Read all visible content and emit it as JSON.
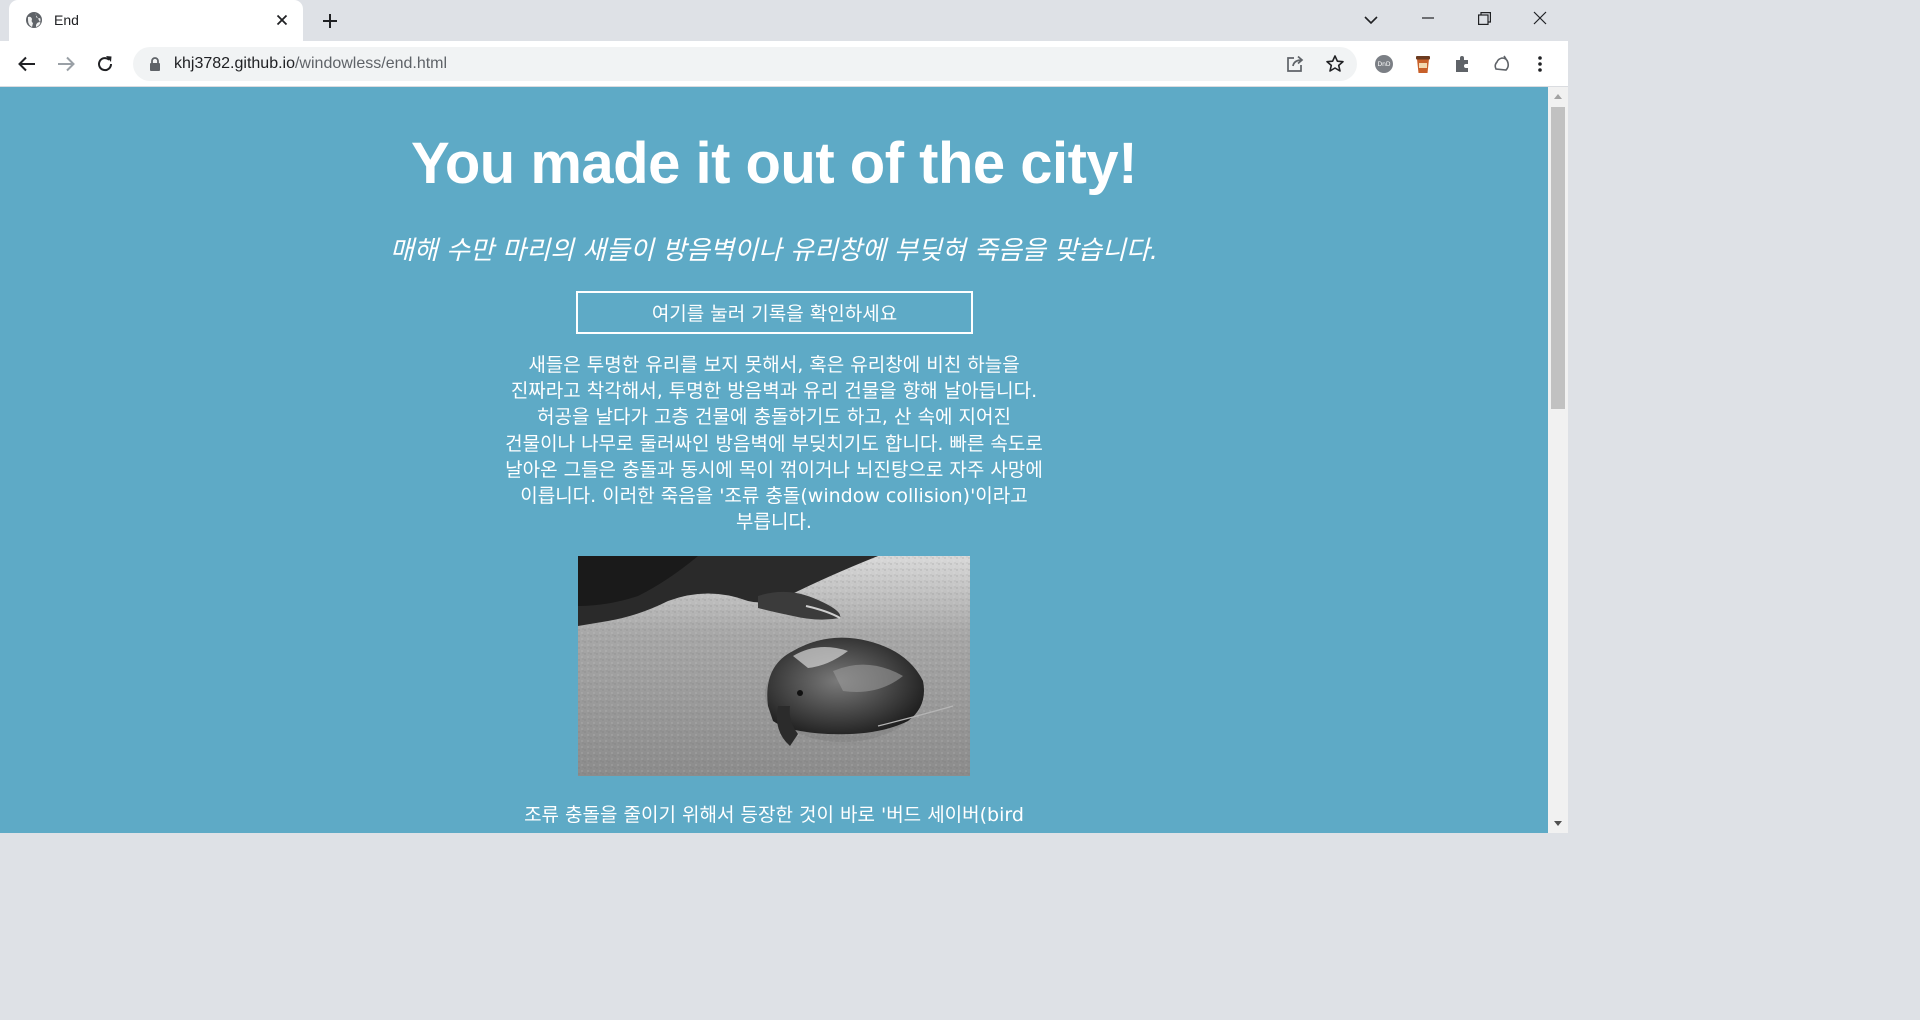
{
  "browser": {
    "tab": {
      "title": "End",
      "favicon": "globe-icon"
    },
    "url": {
      "host": "khj3782.github.io",
      "path": "/windowless/end.html"
    }
  },
  "page": {
    "heading": "You made it out of the city!",
    "subtitle": "매해 수만 마리의 새들이 방음벽이나 유리창에 부딪혀 죽음을 맞습니다.",
    "record_button": "여기를 눌러 기록을 확인하세요",
    "paragraph_lines": [
      "새들은 투명한 유리를 보지 못해서, 혹은 유리창에 비친 하늘을",
      "진짜라고 착각해서, 투명한 방음벽과 유리 건물을 향해 날아듭니다.",
      "허공을 날다가 고층 건물에 충돌하기도 하고, 산 속에 지어진",
      "건물이나 나무로 둘러싸인 방음벽에 부딪치기도 합니다. 빠른 속도로",
      "날아온 그들은 충돌과 동시에 목이 꺾이거나 뇌진탕으로 자주 사망에",
      "이릅니다. 이러한 죽음을 '조류 충돌(window collision)'이라고",
      "부릅니다."
    ],
    "paragraph2_lines": [
      "조류 충돌을 줄이기 위해서 등장한 것이 바로 '버드 세이버(bird"
    ]
  },
  "colors": {
    "page_bg": "#5eaac6",
    "text": "#ffffff"
  }
}
